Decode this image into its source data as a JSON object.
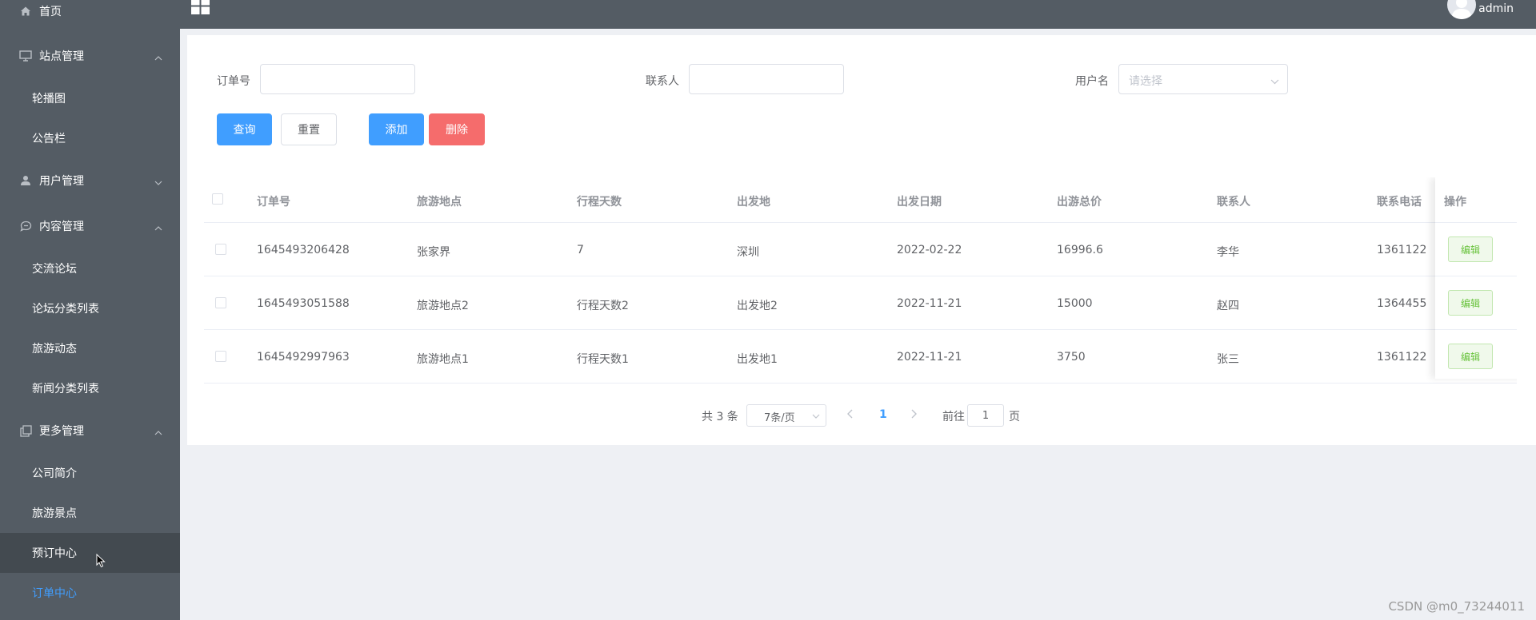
{
  "sidebar": {
    "home": "首页",
    "site_mgmt": "站点管理",
    "carousel": "轮播图",
    "notice": "公告栏",
    "user_mgmt": "用户管理",
    "content_mgmt": "内容管理",
    "forum": "交流论坛",
    "forum_category": "论坛分类列表",
    "travel_news": "旅游动态",
    "news_category": "新闻分类列表",
    "more_mgmt": "更多管理",
    "company_intro": "公司简介",
    "scenic_spots": "旅游景点",
    "booking_center": "预订中心",
    "order_center": "订单中心"
  },
  "header": {
    "username": "admin"
  },
  "search": {
    "order_no_label": "订单号",
    "contact_label": "联系人",
    "username_label": "用户名",
    "username_placeholder": "请选择"
  },
  "buttons": {
    "query": "查询",
    "reset": "重置",
    "add": "添加",
    "delete": "删除"
  },
  "table": {
    "headers": [
      "订单号",
      "旅游地点",
      "行程天数",
      "出发地",
      "出发日期",
      "出游总价",
      "联系人",
      "联系电话",
      "操作"
    ],
    "rows": [
      [
        "1645493206428",
        "张家界",
        "7",
        "深圳",
        "2022-02-22",
        "16996.6",
        "李华",
        "1361122"
      ],
      [
        "1645493051588",
        "旅游地点2",
        "行程天数2",
        "出发地2",
        "2022-11-21",
        "15000",
        "赵四",
        "1364455"
      ],
      [
        "1645492997963",
        "旅游地点1",
        "行程天数1",
        "出发地1",
        "2022-11-21",
        "3750",
        "张三",
        "1361122"
      ]
    ],
    "edit_label": "编辑"
  },
  "pagination": {
    "total": "共 3 条",
    "page_size": "7条/页",
    "current_page": "1",
    "goto_prefix": "前往",
    "goto_value": "1",
    "goto_suffix": "页"
  },
  "watermark": "CSDN @m0_73244011",
  "colors": {
    "sidebar_bg": "#545c64",
    "primary": "#409eff",
    "danger": "#f56c6c",
    "success": "#67c23a"
  }
}
